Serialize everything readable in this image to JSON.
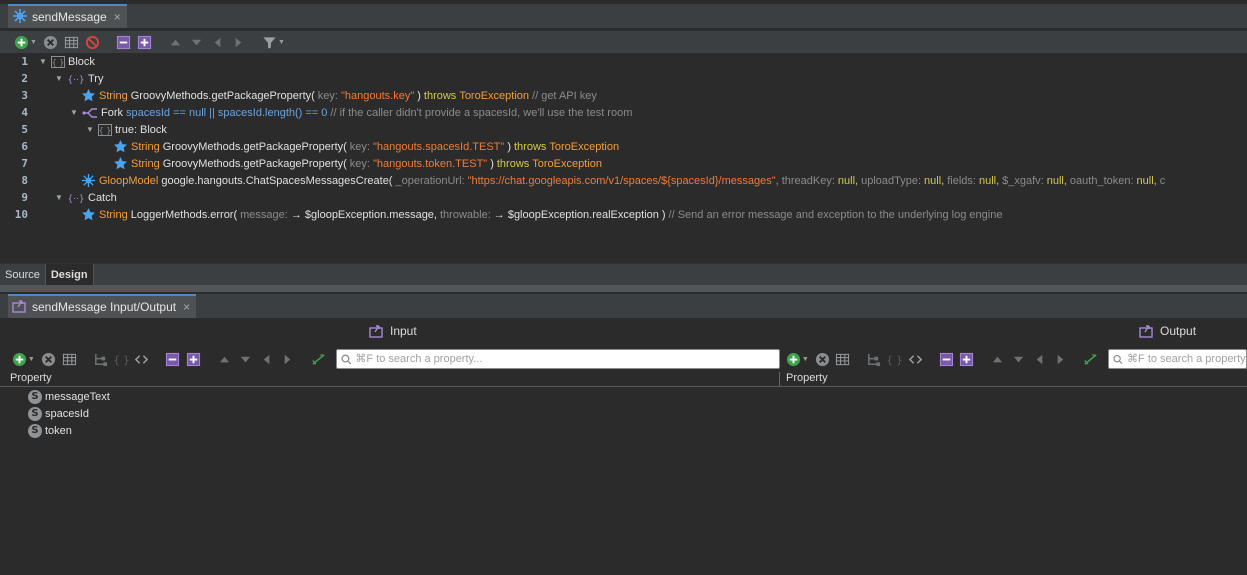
{
  "editor": {
    "tab_title": "sendMessage",
    "tab_close": "×",
    "lines": [
      {
        "num": "1",
        "t1": "Block"
      },
      {
        "num": "2",
        "t1": "Try"
      },
      {
        "num": "3",
        "type": "String",
        "method": "GroovyMethods.getPackageProperty(",
        "param": "key:",
        "arg": "\"hangouts.key\"",
        "close": ")",
        "throws": "throws",
        "exc": "ToroException",
        "comment": "// get API key"
      },
      {
        "num": "4",
        "kw": "Fork",
        "cond": "spacesId == null || spacesId.length() == 0",
        "comment": "// if the caller didn't provide a spacesId, we'll use the test room"
      },
      {
        "num": "5",
        "label": "true:",
        "t1": "Block"
      },
      {
        "num": "6",
        "type": "String",
        "method": "GroovyMethods.getPackageProperty(",
        "param": "key:",
        "arg": "\"hangouts.spacesId.TEST\"",
        "close": ")",
        "throws": "throws",
        "exc": "ToroException"
      },
      {
        "num": "7",
        "type": "String",
        "method": "GroovyMethods.getPackageProperty(",
        "param": "key:",
        "arg": "\"hangouts.token.TEST\"",
        "close": ")",
        "throws": "throws",
        "exc": "ToroException"
      },
      {
        "num": "8",
        "type": "GloopModel",
        "method": "google.hangouts.ChatSpacesMessagesCreate(",
        "p1": "_operationUrl:",
        "a1": "\"https://chat.googleapis.com/v1/spaces/${spacesId}/messages\",",
        "p2": "threadKey:",
        "a2": "null,",
        "p3": "uploadType:",
        "a3": "null,",
        "p4": "fields:",
        "a4": "null,",
        "p5": "$_xgafv:",
        "a5": "null,",
        "p6": "oauth_token:",
        "a6": "null,",
        "p7": "c"
      },
      {
        "num": "9",
        "t1": "Catch"
      },
      {
        "num": "10",
        "type": "String",
        "method": "LoggerMethods.error(",
        "p1": "message:",
        "a1": "→ $gloopException.message,",
        "p2": "throwable:",
        "a2": "→ $gloopException.realException",
        "close": ")",
        "comment": "// Send an error message and exception to the underlying log engine"
      }
    ],
    "bottom_tabs": [
      "Source",
      "Design"
    ]
  },
  "io": {
    "tab_title": "sendMessage Input/Output",
    "tab_close": "×",
    "input_label": "Input",
    "output_label": "Output",
    "search_placeholder": "⌘F to search a property...",
    "property_header": "Property",
    "input_properties": [
      "messageText",
      "spacesId",
      "token"
    ],
    "property_type_glyph": "S"
  },
  "colors": {
    "background": "#2b2b2b",
    "toolbar": "#3c3f41",
    "string_literal": "#f07b3a",
    "type_keyword": "#f29e3d",
    "throws_keyword": "#d6c84b",
    "condition": "#6aa3e0",
    "comment": "#8c8c8c"
  }
}
